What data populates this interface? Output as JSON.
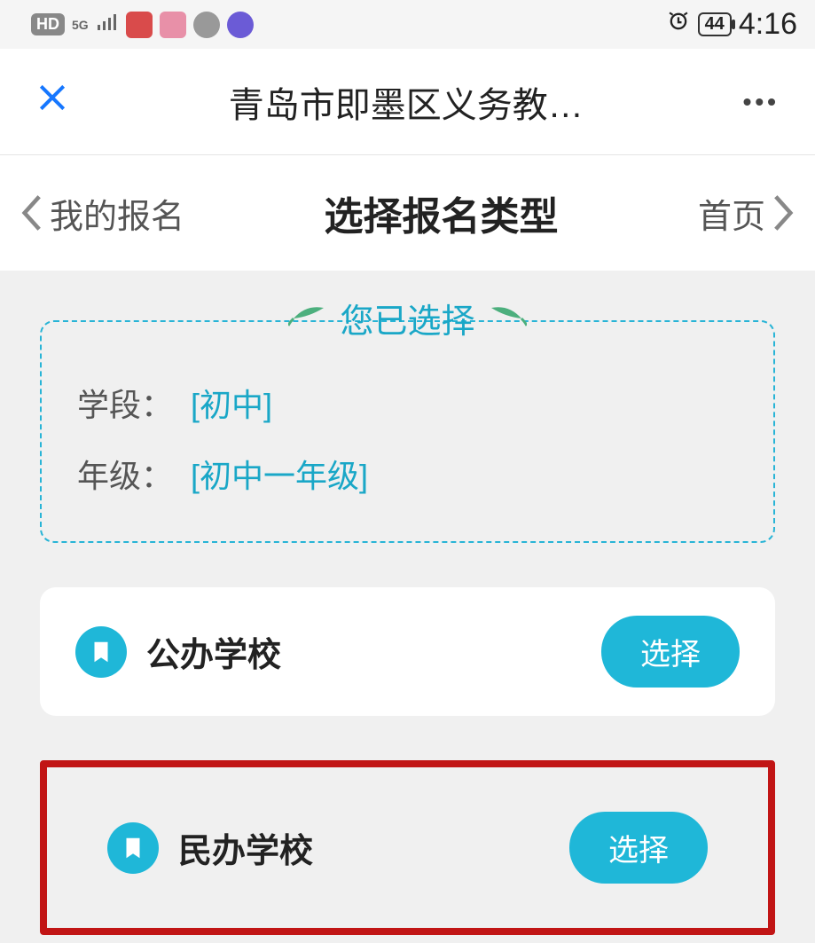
{
  "status": {
    "hd": "HD",
    "net": "5G",
    "battery": "44",
    "time": "4:16"
  },
  "appbar": {
    "title": "青岛市即墨区义务教…"
  },
  "nav": {
    "back_label": "我的报名",
    "center": "选择报名类型",
    "home_label": "首页"
  },
  "selection": {
    "heading": "您已选择",
    "stage_label": "学段：",
    "stage_value": "[初中]",
    "grade_label": "年级：",
    "grade_value": "[初中一年级]"
  },
  "options": [
    {
      "label": "公办学校",
      "button": "选择",
      "highlighted": false
    },
    {
      "label": "民办学校",
      "button": "选择",
      "highlighted": true
    }
  ]
}
